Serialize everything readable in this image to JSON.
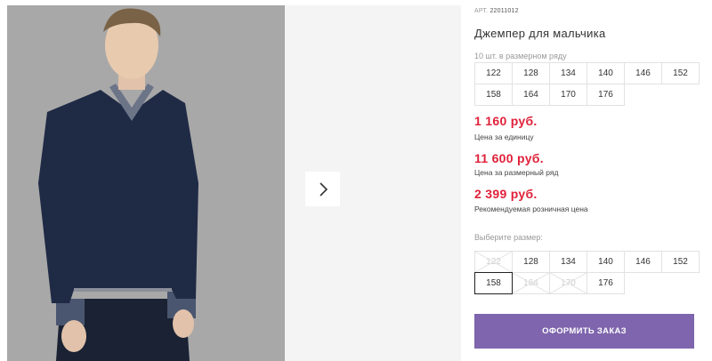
{
  "product": {
    "article_label": "АРТ.",
    "article_value": "22011012",
    "title": "Джемпер для мальчика"
  },
  "pack": {
    "label": "10 шт. в размерном ряду",
    "sizes": [
      "122",
      "128",
      "134",
      "140",
      "146",
      "152",
      "158",
      "164",
      "170",
      "176"
    ]
  },
  "prices": {
    "unit_price": "1 160 руб.",
    "unit_label": "Цена за единицу",
    "pack_price": "11 600 руб.",
    "pack_label": "Цена за размерный ряд",
    "retail_price": "2 399 руб.",
    "retail_label": "Рекомендуемая розничная цена"
  },
  "size_selector": {
    "label": "Выберите размер:",
    "sizes": [
      {
        "label": "122",
        "available": false
      },
      {
        "label": "128",
        "available": true
      },
      {
        "label": "134",
        "available": true
      },
      {
        "label": "140",
        "available": true
      },
      {
        "label": "146",
        "available": true
      },
      {
        "label": "152",
        "available": true
      },
      {
        "label": "158",
        "available": true,
        "selected": true
      },
      {
        "label": "164",
        "available": false
      },
      {
        "label": "170",
        "available": false
      },
      {
        "label": "176",
        "available": true
      }
    ]
  },
  "order_button": {
    "label": "ОФОРМИТЬ ЗАКАЗ"
  },
  "gallery": {
    "next_icon": "chevron-right-icon"
  },
  "colors": {
    "price": "#e0213a",
    "button": "#7e65ad"
  }
}
